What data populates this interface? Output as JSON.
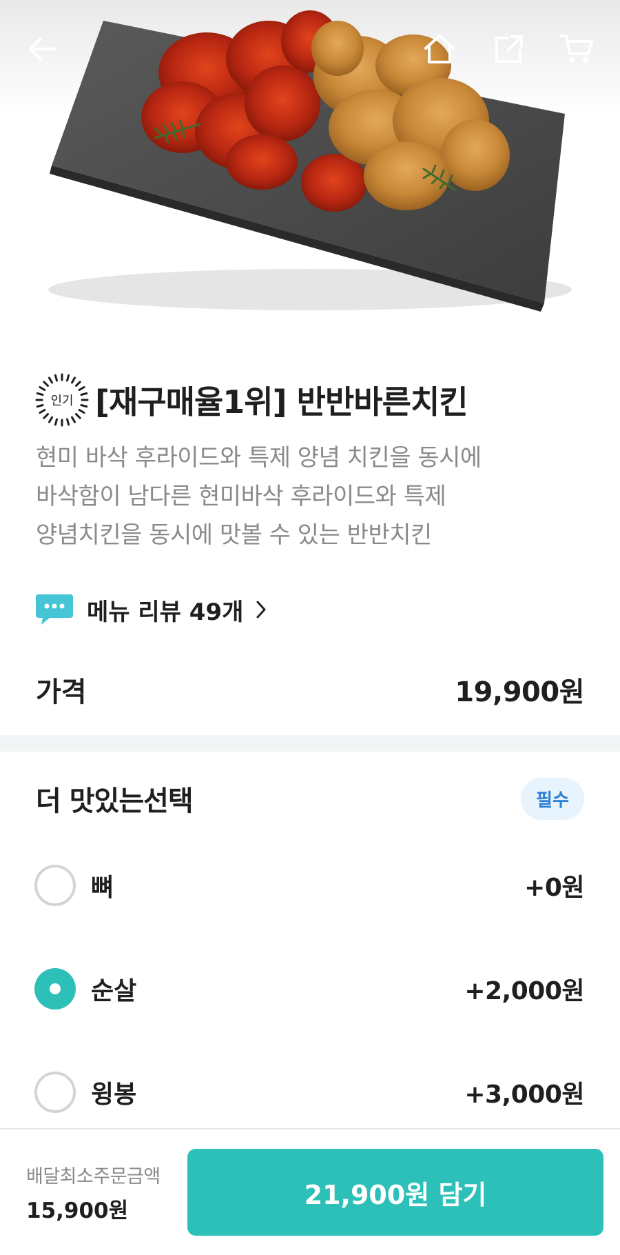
{
  "topbar": {
    "back_icon": "arrow-left-icon",
    "home_icon": "home-icon",
    "share_icon": "share-icon",
    "cart_icon": "cart-icon"
  },
  "product": {
    "badge": "인기",
    "title": "[재구매율1위] 반반바른치킨",
    "description": [
      "현미 바삭 후라이드와 특제 양념 치킨을 동시에",
      "바삭함이 남다른 현미바삭 후라이드와 특제",
      "양념치킨을 동시에 맛볼 수 있는 반반치킨"
    ],
    "review_link": "메뉴 리뷰 49개",
    "price_label": "가격",
    "price": "19,900원"
  },
  "options": {
    "title": "더 맛있는선택",
    "required_badge": "필수",
    "items": [
      {
        "label": "뼈",
        "price": "+0원",
        "selected": false
      },
      {
        "label": "순살",
        "price": "+2,000원",
        "selected": true
      },
      {
        "label": "윙봉",
        "price": "+3,000원",
        "selected": false
      }
    ]
  },
  "footer": {
    "min_order_label": "배달최소주문금액",
    "min_order_value": "15,900원",
    "add_button": "21,900원 담기"
  },
  "colors": {
    "accent": "#2cc0b8",
    "required_badge_bg": "#e7f3fd",
    "required_badge_text": "#2a7fd4",
    "muted_text": "#8a8a8a"
  }
}
